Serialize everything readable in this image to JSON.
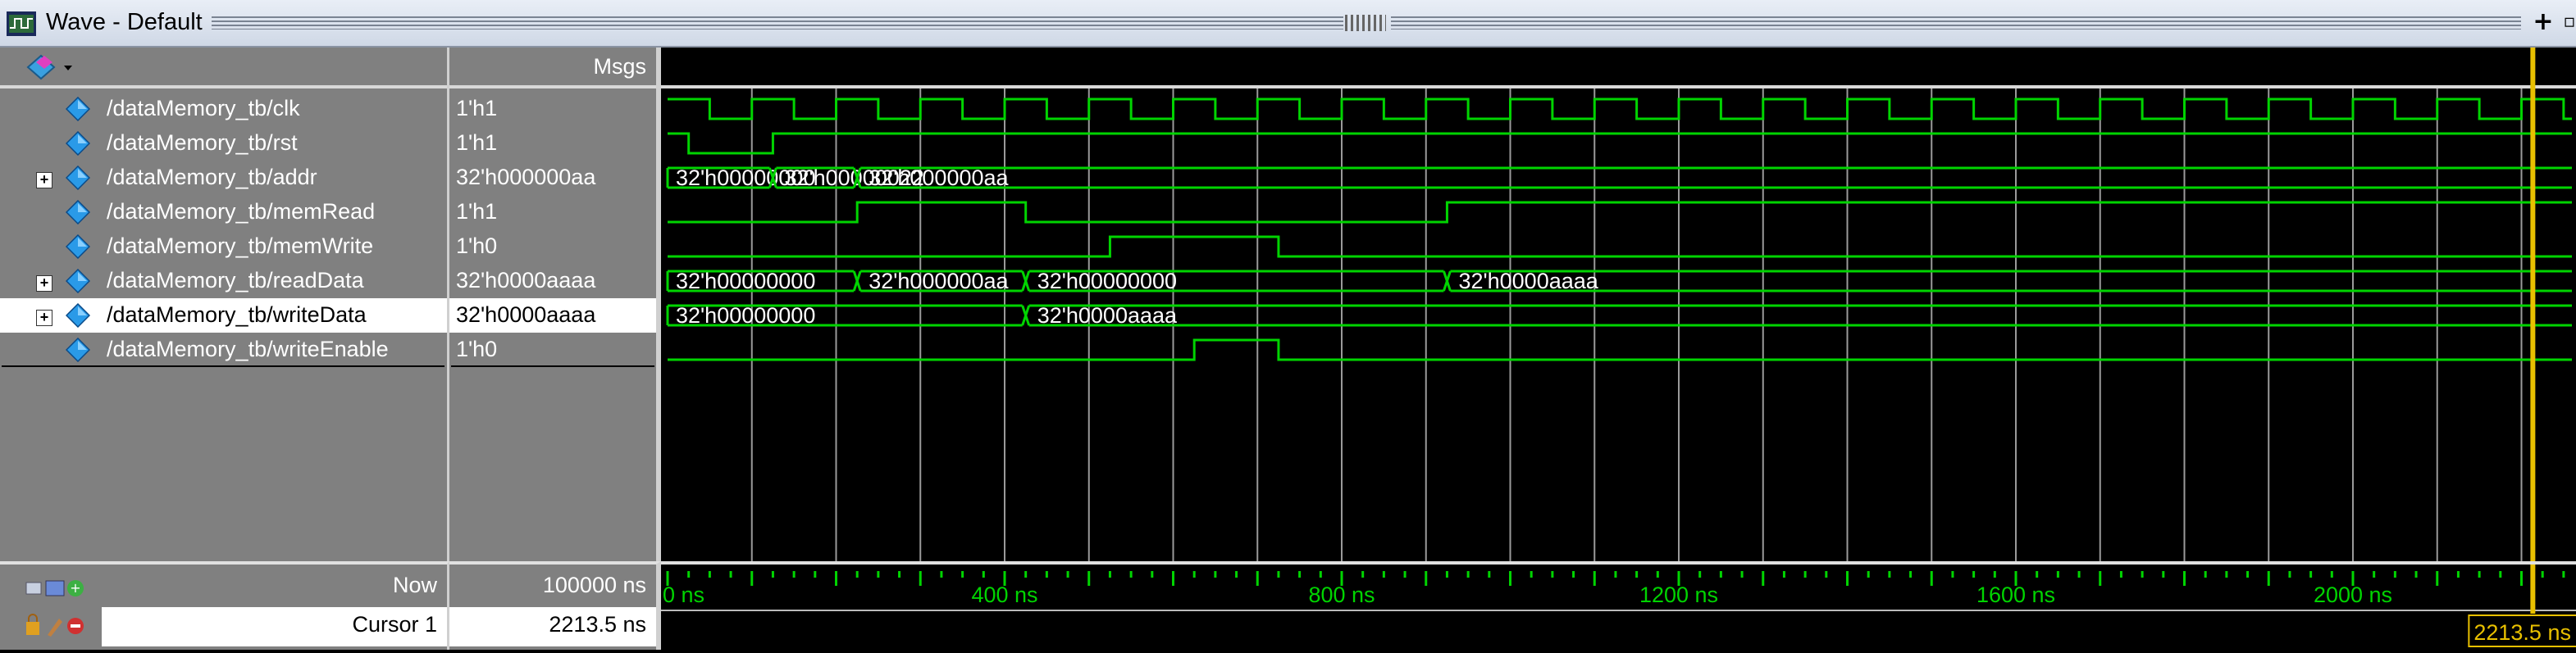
{
  "window": {
    "title": "Wave - Default"
  },
  "header": {
    "msgs_label": "Msgs"
  },
  "signals": [
    {
      "name": "/dataMemory_tb/clk",
      "value": "1'h1",
      "expandable": false
    },
    {
      "name": "/dataMemory_tb/rst",
      "value": "1'h1",
      "expandable": false
    },
    {
      "name": "/dataMemory_tb/addr",
      "value": "32'h000000aa",
      "expandable": true
    },
    {
      "name": "/dataMemory_tb/memRead",
      "value": "1'h1",
      "expandable": false
    },
    {
      "name": "/dataMemory_tb/memWrite",
      "value": "1'h0",
      "expandable": false
    },
    {
      "name": "/dataMemory_tb/readData",
      "value": "32'h0000aaaa",
      "expandable": true
    },
    {
      "name": "/dataMemory_tb/writeData",
      "value": "32'h0000aaaa",
      "expandable": true,
      "selected": true
    },
    {
      "name": "/dataMemory_tb/writeEnable",
      "value": "1'h0",
      "expandable": false
    }
  ],
  "bus_labels": {
    "addr": [
      "32'h00000000",
      "32'h00000022",
      "32'h000000aa"
    ],
    "readData": [
      "32'h00000000",
      "32'h000000aa",
      "32'h00000000",
      "32'h0000aaaa"
    ],
    "writeData": [
      "32'h00000000",
      "32'h0000aaaa"
    ]
  },
  "timeline": {
    "now_label": "Now",
    "now_value": "100000 ns",
    "cursor_label": "Cursor 1",
    "cursor_value": "2213.5 ns",
    "cursor_ns": 2213.5,
    "tick_labels": [
      "0 ns",
      "400 ns",
      "800 ns",
      "1200 ns",
      "1600 ns",
      "2000 ns"
    ],
    "cursor_time_label": "2213.5 ns"
  },
  "colors": {
    "wave": "#00d400",
    "cursor": "#e8c000",
    "grid": "#9a9a9a",
    "pane_bg": "#808080",
    "selected_row": "#ffffff"
  }
}
